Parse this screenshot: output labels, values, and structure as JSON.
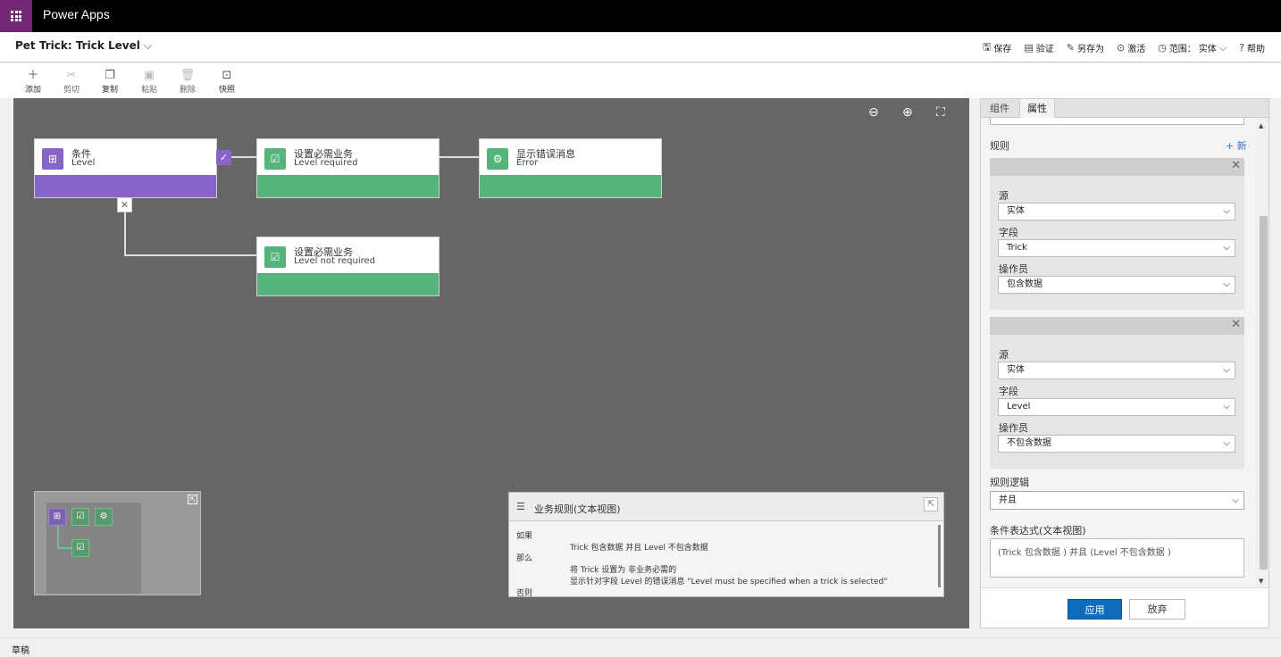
{
  "app": {
    "title": "Power Apps"
  },
  "header": {
    "rule_name": "Pet Trick: Trick Level",
    "commands": [
      {
        "icon": "save-icon",
        "label": "保存"
      },
      {
        "icon": "validate-icon",
        "label": "验证"
      },
      {
        "icon": "save-as-icon",
        "label": "另存为"
      },
      {
        "icon": "activate-icon",
        "label": "激活"
      },
      {
        "icon": "scope-icon",
        "label": "范围：",
        "value": "实体"
      },
      {
        "icon": "help-icon",
        "label": "帮助"
      }
    ]
  },
  "toolbar": {
    "add": "添加",
    "cut": "剪切",
    "copy": "复制",
    "paste": "粘贴",
    "delete": "删除",
    "snapshot": "快照"
  },
  "canvas": {
    "nodes": [
      {
        "type": "condition",
        "title": "条件",
        "subtitle": "Level",
        "color": "#8764c8"
      },
      {
        "type": "action",
        "title": "设置必需业务",
        "subtitle": "Level required",
        "color": "#55b47a"
      },
      {
        "type": "action",
        "title": "显示错误消息",
        "subtitle": "Error",
        "color": "#55b47a"
      },
      {
        "type": "action",
        "title": "设置必需业务",
        "subtitle": "Level not required",
        "color": "#55b47a"
      }
    ]
  },
  "textview": {
    "title": "业务规则(文本视图)",
    "if_label": "如果",
    "if_text": "Trick 包含数据 并且 Level 不包含数据",
    "then_label": "那么",
    "then_line1": "将 Trick 设置为 非业务必需的",
    "then_line2": "显示针对字段 Level 的错误消息 \"Level must be specified when a trick is selected\"",
    "else_label": "否则"
  },
  "panel": {
    "tabs": [
      "组件",
      "属性"
    ],
    "active_tab": "属性",
    "rules_label": "规则",
    "new_label": "+ 新",
    "rules": [
      {
        "source_label": "源",
        "source": "实体",
        "field_label": "字段",
        "field": "Trick",
        "operator_label": "操作员",
        "operator": "包含数据"
      },
      {
        "source_label": "源",
        "source": "实体",
        "field_label": "字段",
        "field": "Level",
        "operator_label": "操作员",
        "operator": "不包含数据"
      }
    ],
    "logic_label": "规则逻辑",
    "logic_value": "并且",
    "expression_label": "条件表达式(文本视图)",
    "expression_value": "(Trick 包含数据 ) 并且 (Level 不包含数据 )",
    "apply": "应用",
    "discard": "放弃"
  },
  "status": {
    "text": "草稿"
  }
}
